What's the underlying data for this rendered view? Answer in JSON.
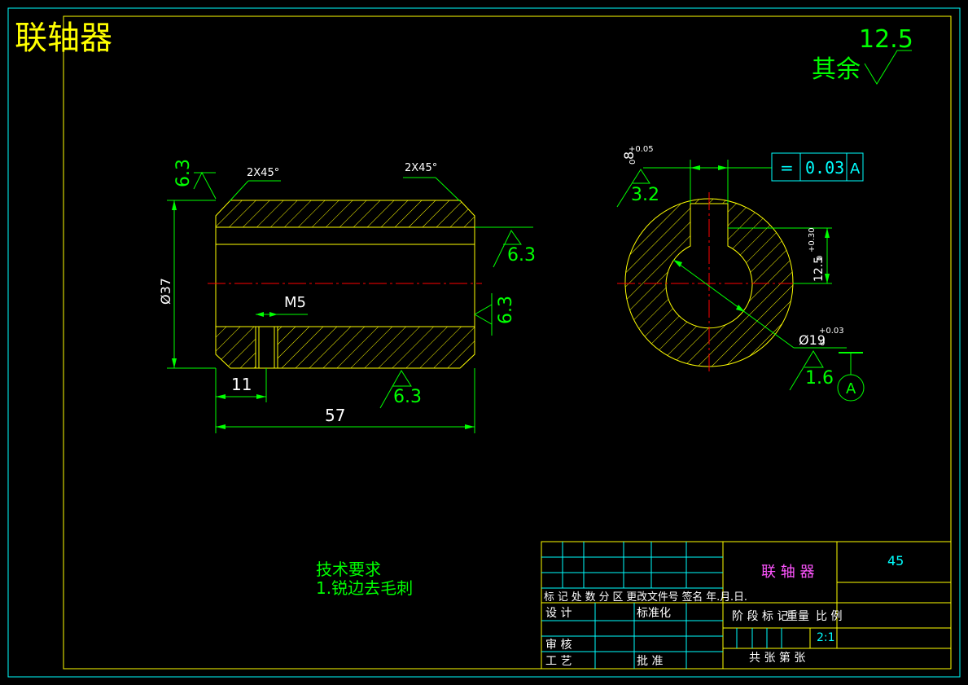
{
  "title": "联轴器",
  "roughness": {
    "default_value": "12.5",
    "default_label": "其余",
    "left_top": "6.3",
    "right_upper": "6.3",
    "right_face": "6.3",
    "bottom": "6.3",
    "keyway": "3.2",
    "bore": "1.6"
  },
  "dimensions": {
    "chamfer_left": "2X45°",
    "chamfer_right": "2X45°",
    "diameter": "Ø37",
    "thread": "M5",
    "thread_position": "11",
    "length": "57",
    "keyway_width": "8",
    "keyway_width_zero": "0",
    "keyway_width_tol": "+0.05",
    "keyway_depth": "12.5",
    "keyway_depth_zero": "0",
    "keyway_depth_tol": "+0.30",
    "bore_diameter": "Ø19",
    "bore_diameter_zero": "0",
    "bore_diameter_tol": "+0.03"
  },
  "tolerance_frame": {
    "symbol": "=",
    "value": "0.03",
    "datum": "A"
  },
  "datum_label": "A",
  "tech_requirements": {
    "heading": "技术要求",
    "item1": "1.锐边去毛刺"
  },
  "title_block": {
    "part_name": "联 轴 器",
    "material": "45",
    "header_row": "标 记 处 数 分 区 更改文件号 签名 年.月.日.",
    "design": "设 计",
    "standardize": "标准化",
    "stage_label": "阶 段 标 记",
    "weight_label": "重量",
    "scale_label": "比 例",
    "scale_value": "2:1",
    "review": "审 核",
    "process": "工 艺",
    "approve": "批 准",
    "sheets": "共   张 第   张"
  },
  "colors": {
    "background": "#000000",
    "border": "#ffff00",
    "outline": "#ffff00",
    "dimension": "#00ff00",
    "frame_cyan": "#00ffff",
    "centerline": "#ff0000",
    "text_white": "#ffffff"
  }
}
